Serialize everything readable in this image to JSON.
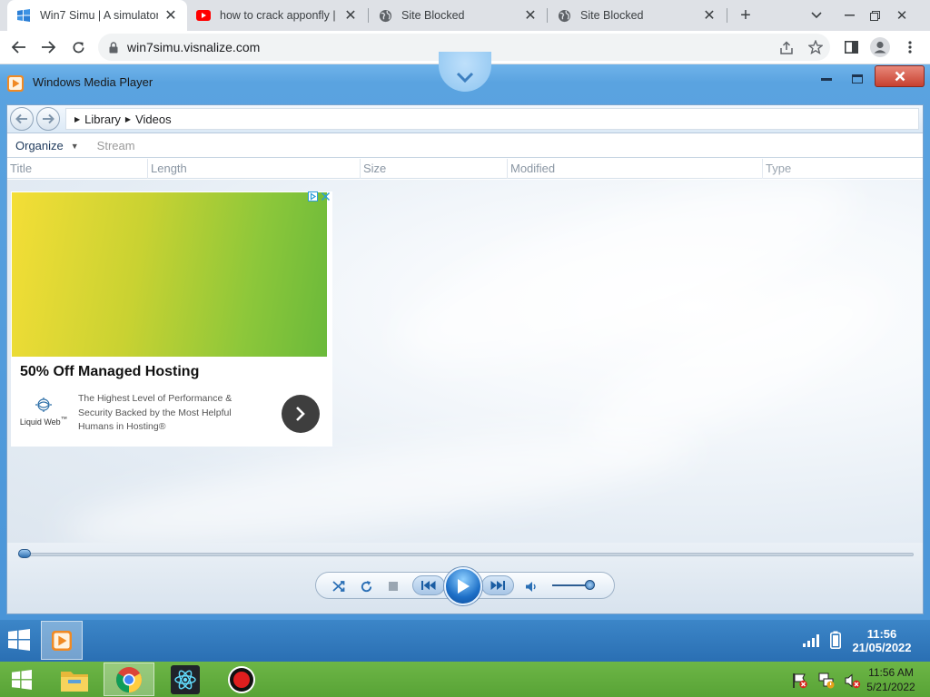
{
  "browser": {
    "tabs": [
      {
        "title": "Win7 Simu | A simulator of",
        "icon": "win7-simu-favicon",
        "active": true
      },
      {
        "title": "how to crack apponfly | C",
        "icon": "youtube-icon",
        "active": false
      },
      {
        "title": "Site Blocked",
        "icon": "globe-icon",
        "active": false
      },
      {
        "title": "Site Blocked",
        "icon": "globe-icon",
        "active": false
      }
    ],
    "url": "win7simu.visnalize.com"
  },
  "wmp": {
    "title": "Windows Media Player",
    "breadcrumb": [
      "Library",
      "Videos"
    ],
    "organize_label": "Organize",
    "stream_label": "Stream",
    "columns": [
      "Title",
      "Length",
      "Size",
      "Modified",
      "Type"
    ],
    "ad": {
      "headline": "50% Off Managed Hosting",
      "description": "The Highest Level of Performance & Security Backed by the Most Helpful Humans in Hosting®",
      "brand": "Liquid Web",
      "brand_mark": "™",
      "image_colors": [
        "#f4de36",
        "#6ab93a"
      ]
    },
    "seek_position": 0,
    "volume": 0.9
  },
  "sim_taskbar": {
    "time": "11:56",
    "date": "21/05/2022"
  },
  "host_taskbar": {
    "time": "11:56 AM",
    "date": "5/21/2022",
    "apps": [
      "file-explorer-icon",
      "chrome-icon",
      "react-devtools-icon",
      "record-icon"
    ]
  }
}
